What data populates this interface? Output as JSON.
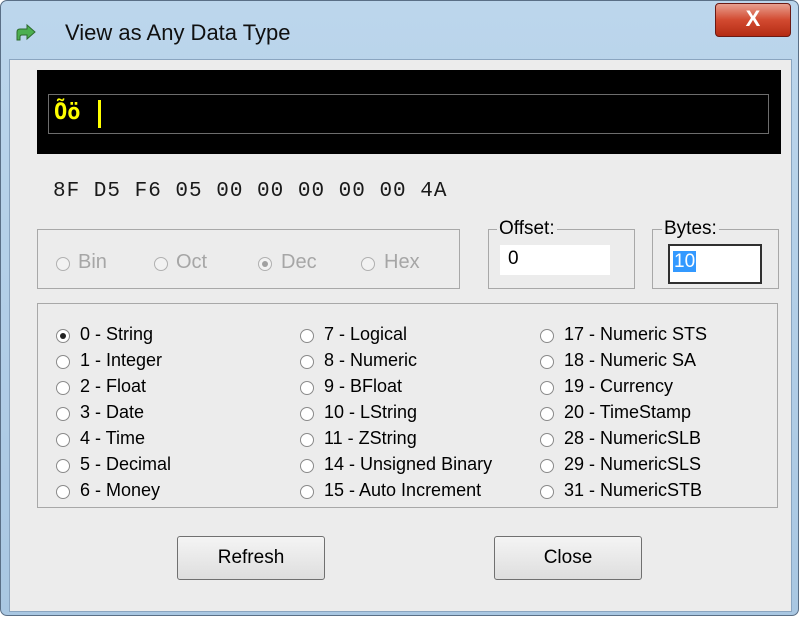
{
  "window": {
    "title": "View as Any Data Type",
    "close_glyph": "X",
    "app_icon": "arrow-right-icon"
  },
  "display": {
    "text_value": "Õö",
    "hex_bytes": "8F D5 F6 05 00 00 00 00 00 4A"
  },
  "base_options": [
    {
      "label": "Bin",
      "selected": false
    },
    {
      "label": "Oct",
      "selected": false
    },
    {
      "label": "Dec",
      "selected": true
    },
    {
      "label": "Hex",
      "selected": false
    }
  ],
  "offset": {
    "label": "Offset:",
    "value": "0"
  },
  "bytes": {
    "label": "Bytes:",
    "value": "10"
  },
  "types": [
    {
      "label": "0 - String",
      "selected": true
    },
    {
      "label": "1 - Integer",
      "selected": false
    },
    {
      "label": "2 - Float",
      "selected": false
    },
    {
      "label": "3 - Date",
      "selected": false
    },
    {
      "label": "4 - Time",
      "selected": false
    },
    {
      "label": "5 - Decimal",
      "selected": false
    },
    {
      "label": "6 - Money",
      "selected": false
    },
    {
      "label": "7 - Logical",
      "selected": false
    },
    {
      "label": "8 - Numeric",
      "selected": false
    },
    {
      "label": "9 - BFloat",
      "selected": false
    },
    {
      "label": "10 - LString",
      "selected": false
    },
    {
      "label": "11 - ZString",
      "selected": false
    },
    {
      "label": "14 - Unsigned Binary",
      "selected": false
    },
    {
      "label": "15 - Auto Increment",
      "selected": false
    },
    {
      "label": "17 - Numeric STS",
      "selected": false
    },
    {
      "label": "18 - Numeric SA",
      "selected": false
    },
    {
      "label": "19 - Currency",
      "selected": false
    },
    {
      "label": "20 - TimeStamp",
      "selected": false
    },
    {
      "label": "28 - NumericSLB",
      "selected": false
    },
    {
      "label": "29 - NumericSLS",
      "selected": false
    },
    {
      "label": "31 - NumericSTB",
      "selected": false
    }
  ],
  "buttons": {
    "refresh_label": "Refresh",
    "close_label": "Close"
  }
}
